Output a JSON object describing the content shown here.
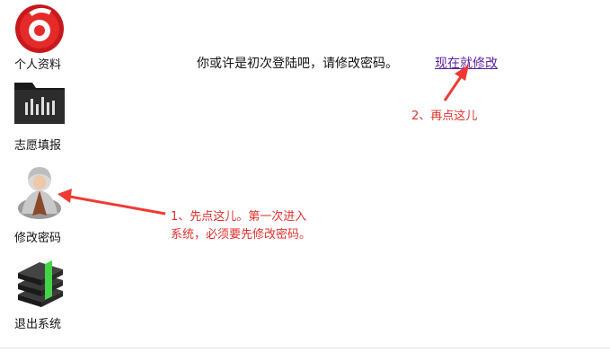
{
  "sidebar": {
    "items": [
      {
        "label": "个人资料",
        "icon": "profile-logo-icon"
      },
      {
        "label": "志愿填报",
        "icon": "folder-icon"
      },
      {
        "label": "修改密码",
        "icon": "user-avatar-icon"
      },
      {
        "label": "退出系统",
        "icon": "books-icon"
      }
    ]
  },
  "main": {
    "message": "你或许是初次登陆吧，请修改密码。",
    "link_label": "现在就修改"
  },
  "annotations": {
    "note2": "2、再点这儿",
    "note1_line1": "1、先点这儿。第一次进入",
    "note1_line2": "系统，必须要先修改密码。"
  },
  "colors": {
    "annotation": "#e0302c",
    "link": "#5a1fa0"
  }
}
